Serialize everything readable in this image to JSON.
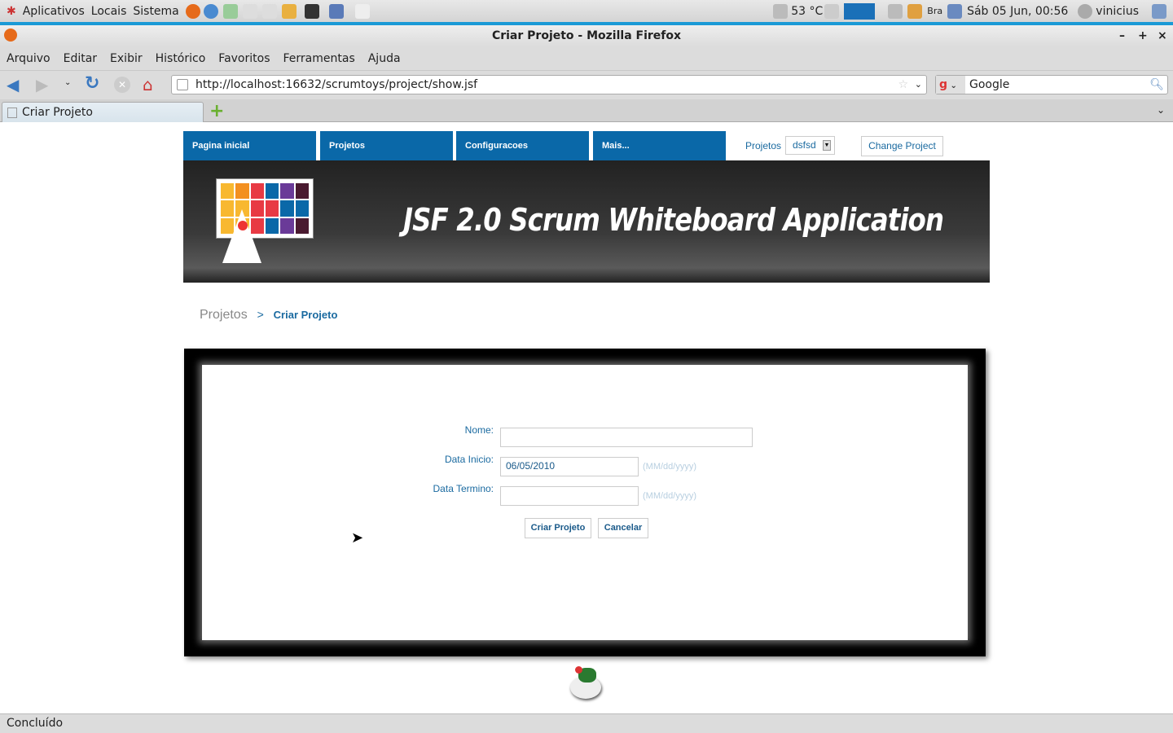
{
  "panel": {
    "menus": [
      "Aplicativos",
      "Locais",
      "Sistema"
    ],
    "temperature": "53 °C",
    "keyboard": "Bra",
    "datetime": "Sáb 05 Jun, 00:56",
    "user": "vinicius"
  },
  "window": {
    "title": "Criar Projeto - Mozilla Firefox",
    "controls": [
      "–",
      "+",
      "×"
    ]
  },
  "menubar": [
    "Arquivo",
    "Editar",
    "Exibir",
    "Histórico",
    "Favoritos",
    "Ferramentas",
    "Ajuda"
  ],
  "navbar": {
    "url": "http://localhost:16632/scrumtoys/project/show.jsf",
    "search": "Google"
  },
  "tab": {
    "label": "Criar Projeto"
  },
  "page": {
    "nav": [
      "Pagina inicial",
      "Projetos",
      "Configuracoes",
      "Mais..."
    ],
    "project_label": "Projetos",
    "project_select": "dsfsd",
    "change_project": "Change Project",
    "banner_title": "JSF 2.0 Scrum Whiteboard Application",
    "breadcrumb": {
      "parent": "Projetos",
      "separator": ">",
      "current": "Criar Projeto"
    },
    "form": {
      "nome_label": "Nome:",
      "nome_value": "",
      "inicio_label": "Data Inicio:",
      "inicio_value": "06/05/2010",
      "termino_label": "Data Termino:",
      "termino_value": "",
      "date_hint": "(MM/dd/yyyy)",
      "submit": "Criar Projeto",
      "cancel": "Cancelar"
    }
  },
  "status": "Concluído",
  "colors": {
    "nav": "#0a68a8",
    "link": "#1a6aa0"
  }
}
